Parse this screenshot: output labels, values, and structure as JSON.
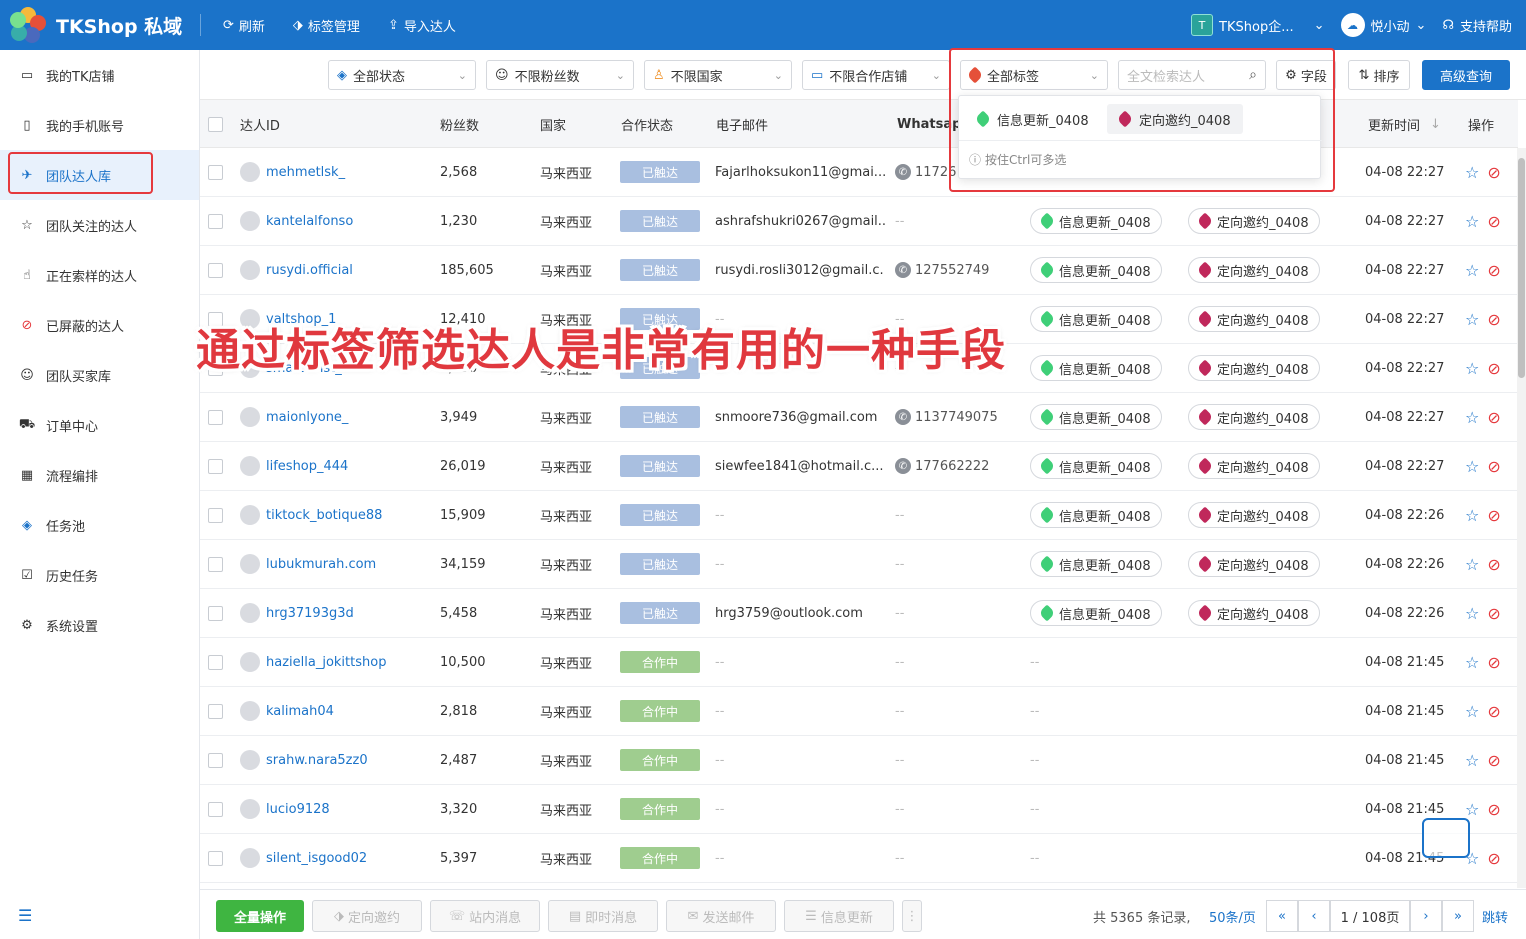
{
  "app": {
    "title": "TKShop 私域"
  },
  "toolbar": {
    "refresh": "刷新",
    "tags": "标签管理",
    "import": "导入达人"
  },
  "header_right": {
    "team_badge": "T",
    "team_name": "TKShop企...",
    "user": "悦小动",
    "help": "支持帮助"
  },
  "sidebar": {
    "items": [
      {
        "label": "我的TK店铺",
        "icon": "store-icon"
      },
      {
        "label": "我的手机账号",
        "icon": "phone-icon"
      },
      {
        "label": "团队达人库",
        "icon": "creator-library-icon",
        "active": true
      },
      {
        "label": "团队关注的达人",
        "icon": "star-icon"
      },
      {
        "label": "正在索样的达人",
        "icon": "hand-icon"
      },
      {
        "label": "已屏蔽的达人",
        "icon": "ban-icon"
      },
      {
        "label": "团队买家库",
        "icon": "user-icon"
      },
      {
        "label": "订单中心",
        "icon": "truck-icon"
      },
      {
        "label": "流程编排",
        "icon": "calendar-icon"
      },
      {
        "label": "任务池",
        "icon": "layers-icon"
      },
      {
        "label": "历史任务",
        "icon": "clipboard-icon"
      },
      {
        "label": "系统设置",
        "icon": "gear-icon"
      }
    ]
  },
  "filters": {
    "status": "全部状态",
    "followers": "不限粉丝数",
    "country": "不限国家",
    "shop": "不限合作店铺",
    "tags": "全部标签",
    "search_placeholder": "全文检索达人",
    "fields": "字段",
    "sort": "排序",
    "advanced": "高级查询"
  },
  "dropdown": {
    "options": [
      {
        "label": "信息更新_0408",
        "color": "#3fcf78"
      },
      {
        "label": "定向邀约_0408",
        "color": "#c0285b",
        "selected": true
      }
    ],
    "hint": "按住Ctrl可多选"
  },
  "table": {
    "headers": {
      "id": "达人ID",
      "followers": "粉丝数",
      "country": "国家",
      "status": "合作状态",
      "email": "电子邮件",
      "whatsapp": "Whatsapp",
      "updated": "更新时间",
      "actions": "操作"
    },
    "rows": [
      {
        "id": "mehmetlsk_",
        "followers": "2,568",
        "country": "马来西亚",
        "status": "已触达",
        "email": "Fajarlhoksukon11@gmai...",
        "whatsapp": "11726",
        "tag1": "",
        "tag2": "",
        "updated": "04-08 22:27"
      },
      {
        "id": "kantelalfonso",
        "followers": "1,230",
        "country": "马来西亚",
        "status": "已触达",
        "email": "ashrafshukri0267@gmail...",
        "whatsapp": "",
        "tag1": "信息更新_0408",
        "tag2": "定向邀约_0408",
        "updated": "04-08 22:27"
      },
      {
        "id": "rusydi.official",
        "followers": "185,605",
        "country": "马来西亚",
        "status": "已触达",
        "email": "rusydi.rosli3012@gmail.c...",
        "whatsapp": "127552749",
        "tag1": "信息更新_0408",
        "tag2": "定向邀约_0408",
        "updated": "04-08 22:27"
      },
      {
        "id": "valtshop_1",
        "followers": "12,410",
        "country": "马来西亚",
        "status": "已触达",
        "email": "",
        "whatsapp": "",
        "tag1": "信息更新_0408",
        "tag2": "定向邀约_0408",
        "updated": "04-08 22:27"
      },
      {
        "id": "smartwrist_",
        "followers": "6,030",
        "country": "马来西亚",
        "status": "已触达",
        "email": "",
        "whatsapp": "",
        "tag1": "信息更新_0408",
        "tag2": "定向邀约_0408",
        "updated": "04-08 22:27"
      },
      {
        "id": "maionlyone_",
        "followers": "3,949",
        "country": "马来西亚",
        "status": "已触达",
        "email": "snmoore736@gmail.com",
        "whatsapp": "1137749075",
        "tag1": "信息更新_0408",
        "tag2": "定向邀约_0408",
        "updated": "04-08 22:27"
      },
      {
        "id": "lifeshop_444",
        "followers": "26,019",
        "country": "马来西亚",
        "status": "已触达",
        "email": "siewfee1841@hotmail.c...",
        "whatsapp": "177662222",
        "tag1": "信息更新_0408",
        "tag2": "定向邀约_0408",
        "updated": "04-08 22:27"
      },
      {
        "id": "tiktock_botique88",
        "followers": "15,909",
        "country": "马来西亚",
        "status": "已触达",
        "email": "",
        "whatsapp": "",
        "tag1": "信息更新_0408",
        "tag2": "定向邀约_0408",
        "updated": "04-08 22:26"
      },
      {
        "id": "lubukmurah.com",
        "followers": "34,159",
        "country": "马来西亚",
        "status": "已触达",
        "email": "",
        "whatsapp": "",
        "tag1": "信息更新_0408",
        "tag2": "定向邀约_0408",
        "updated": "04-08 22:26"
      },
      {
        "id": "hrg37193g3d",
        "followers": "5,458",
        "country": "马来西亚",
        "status": "已触达",
        "email": "hrg3759@outlook.com",
        "whatsapp": "",
        "tag1": "信息更新_0408",
        "tag2": "定向邀约_0408",
        "updated": "04-08 22:26"
      },
      {
        "id": "haziella_jokittshop",
        "followers": "10,500",
        "country": "马来西亚",
        "status": "合作中",
        "email": "",
        "whatsapp": "",
        "tag1": "",
        "tag2": "",
        "updated": "04-08 21:45"
      },
      {
        "id": "kalimah04",
        "followers": "2,818",
        "country": "马来西亚",
        "status": "合作中",
        "email": "",
        "whatsapp": "",
        "tag1": "",
        "tag2": "",
        "updated": "04-08 21:45"
      },
      {
        "id": "srahw.nara5zz0",
        "followers": "2,487",
        "country": "马来西亚",
        "status": "合作中",
        "email": "",
        "whatsapp": "",
        "tag1": "",
        "tag2": "",
        "updated": "04-08 21:45"
      },
      {
        "id": "lucio9128",
        "followers": "3,320",
        "country": "马来西亚",
        "status": "合作中",
        "email": "",
        "whatsapp": "",
        "tag1": "",
        "tag2": "",
        "updated": "04-08 21:45"
      },
      {
        "id": "silent_isgood02",
        "followers": "5,397",
        "country": "马来西亚",
        "status": "合作中",
        "email": "",
        "whatsapp": "",
        "tag1": "",
        "tag2": "",
        "updated": "04-08 21:45"
      }
    ],
    "empty": "--"
  },
  "footer": {
    "bulk": "全量操作",
    "invite": "定向邀约",
    "site_msg": "站内消息",
    "instant_msg": "即时消息",
    "send_mail": "发送邮件",
    "info_update": "信息更新",
    "more": "⋮",
    "total": "共 5365 条记录,",
    "page_size": "50条/页",
    "page": "1 / 108页",
    "jump": "跳转"
  },
  "overlay": {
    "caption": "通过标签筛选达人是非常有用的一种手段"
  },
  "colors": {
    "brand": "#1b73c9",
    "highlight": "#e5393d",
    "touched": "#a9bfe0",
    "cooperating": "#9fcd8f"
  }
}
